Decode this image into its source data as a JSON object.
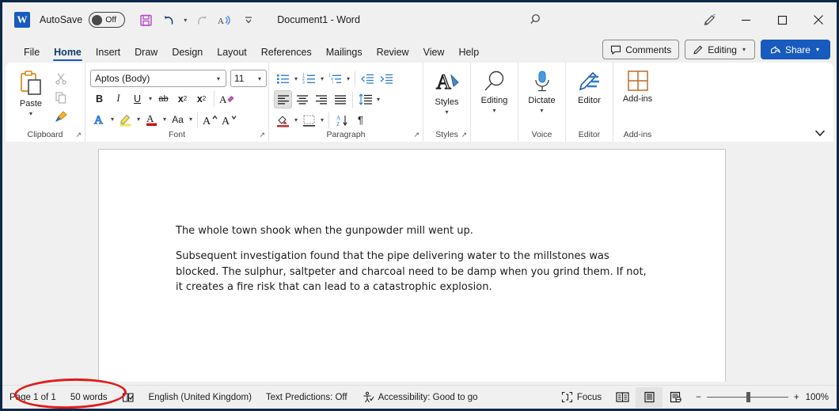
{
  "window": {
    "title": "Document1  -  Word",
    "autosave_label": "AutoSave",
    "autosave_state": "Off",
    "frame_color": "#0d2749"
  },
  "quick_access": {
    "items": [
      {
        "name": "save-icon",
        "tooltip": "Save"
      },
      {
        "name": "undo-icon",
        "tooltip": "Undo"
      },
      {
        "name": "redo-icon",
        "tooltip": "Redo"
      },
      {
        "name": "read-aloud-icon",
        "tooltip": "Read Aloud"
      },
      {
        "name": "customize-quick-access-icon",
        "tooltip": "Customize Quick Access Toolbar"
      }
    ]
  },
  "window_controls": {
    "search": "search-icon",
    "draw_tools": "pen-draw-icon",
    "minimize": "minimize-icon",
    "maximize": "maximize-icon",
    "close": "close-icon"
  },
  "tabs": [
    {
      "label": "File",
      "active": false
    },
    {
      "label": "Home",
      "active": true
    },
    {
      "label": "Insert",
      "active": false
    },
    {
      "label": "Draw",
      "active": false
    },
    {
      "label": "Design",
      "active": false
    },
    {
      "label": "Layout",
      "active": false
    },
    {
      "label": "References",
      "active": false
    },
    {
      "label": "Mailings",
      "active": false
    },
    {
      "label": "Review",
      "active": false
    },
    {
      "label": "View",
      "active": false
    },
    {
      "label": "Help",
      "active": false
    }
  ],
  "tabbar_right": {
    "comments_label": "Comments",
    "editing_label": "Editing",
    "share_label": "Share"
  },
  "ribbon": {
    "accent_color": "#185abd",
    "groups": [
      {
        "label": "Clipboard",
        "paste_label": "Paste",
        "buttons": [
          "cut-icon",
          "copy-icon",
          "format-painter-icon"
        ]
      },
      {
        "label": "Font",
        "font_family": "Aptos (Body)",
        "font_size": "11",
        "buttons": [
          "bold",
          "italic",
          "underline",
          "strikethrough",
          "subscript",
          "superscript",
          "clear-formatting",
          "text-effects",
          "text-highlight-color",
          "font-color",
          "change-case",
          "grow-font",
          "shrink-font"
        ],
        "bold_label": "B",
        "italic_label": "I",
        "underline_label": "U",
        "strike_label": "ab",
        "subscript_label": "x",
        "subscript_sub": "2",
        "superscript_label": "x",
        "superscript_sup": "2",
        "clear_label": "A",
        "case_label": "Aa",
        "grow_label": "A",
        "shrink_label": "A",
        "effects_label": "A",
        "highlight_label": "A",
        "color_label": "A"
      },
      {
        "label": "Paragraph",
        "buttons": [
          "bullets",
          "numbering",
          "multilevel-list",
          "decrease-indent",
          "increase-indent",
          "align-left",
          "align-center",
          "align-right",
          "justify",
          "line-spacing",
          "shading",
          "borders",
          "sort",
          "show-formatting-marks"
        ],
        "pilcrow": "¶"
      },
      {
        "label": "Styles",
        "button_label": "Styles"
      },
      {
        "label": "",
        "button_label": "Editing"
      },
      {
        "label": "Voice",
        "button_label": "Dictate"
      },
      {
        "label": "Editor",
        "button_label": "Editor"
      },
      {
        "label": "Add-ins",
        "button_label": "Add-ins"
      }
    ],
    "collapse_icon": "chevron-down-icon"
  },
  "document": {
    "paragraphs": [
      "The whole town shook when the gunpowder mill went up.",
      "Subsequent investigation found that the pipe delivering water to the millstones was blocked. The sulphur, saltpeter and charcoal need to be damp when you grind them. If not, it creates a fire risk that can lead to a catastrophic explosion."
    ]
  },
  "status_bar": {
    "page": "Page 1 of 1",
    "words": "50 words",
    "proofing_icon": "proofing-errors-icon",
    "language": "English (United Kingdom)",
    "text_predictions": "Text Predictions: Off",
    "accessibility": "Accessibility: Good to go",
    "focus": "Focus",
    "views": [
      {
        "name": "read-mode-view-button",
        "active": false
      },
      {
        "name": "print-layout-view-button",
        "active": true
      },
      {
        "name": "web-layout-view-button",
        "active": false
      }
    ],
    "zoom_out": "−",
    "zoom_in": "+",
    "zoom_level": "100%"
  },
  "annotation": {
    "shape": "ellipse",
    "color": "#e01b1b",
    "target": "50 words"
  }
}
